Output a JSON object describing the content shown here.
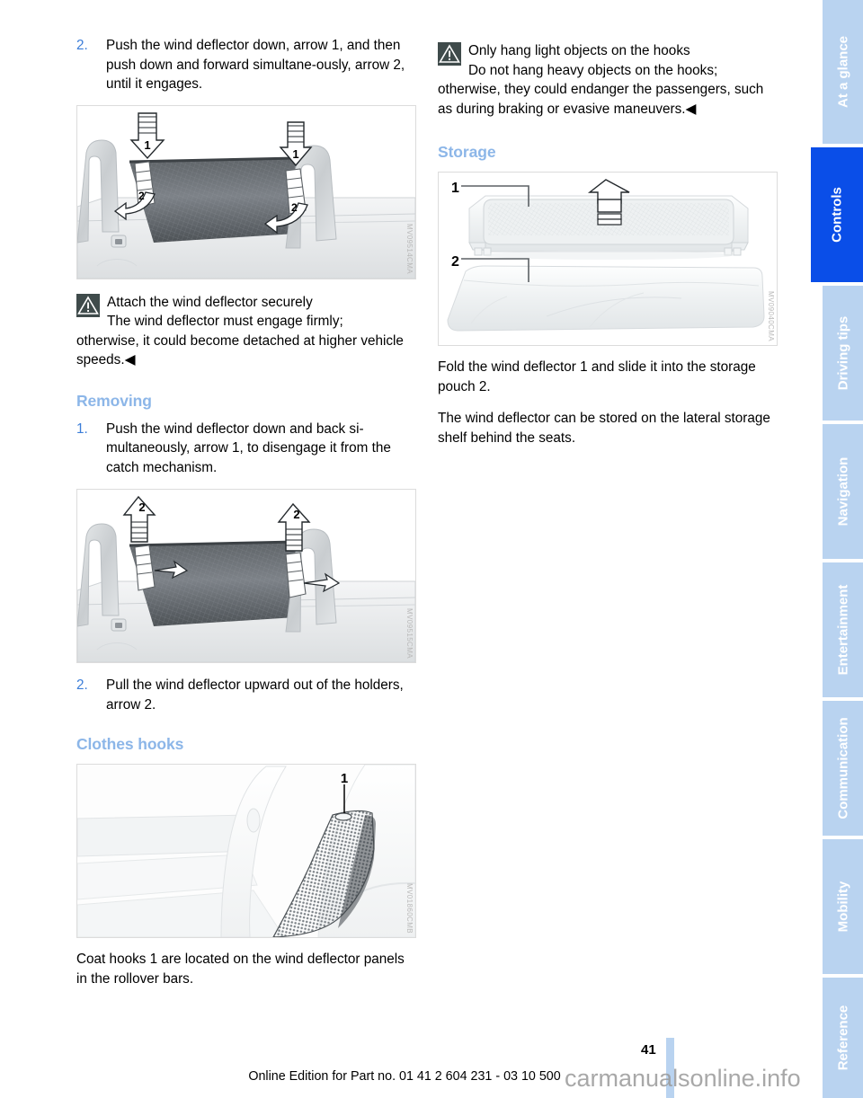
{
  "page": {
    "number": "41",
    "footer": "Online Edition for Part no. 01 41 2 604 231 - 03 10 500",
    "watermark": "carmanualsonline.info"
  },
  "left_column": {
    "step2": {
      "num": "2.",
      "text": "Push the wind deflector down, arrow 1, and then push down and forward simultane-ously, arrow 2, until it engages."
    },
    "figure1": {
      "code": "MV09514CMA",
      "alt": "Wind deflector between rollover bars with down arrows 1 and curved arrows 2"
    },
    "warning": {
      "icon": "warning-triangle-icon",
      "title": "Attach the wind deflector securely",
      "body": "The wind deflector must engage firmly;",
      "rest": "otherwise, it could become detached at higher vehicle speeds.◀"
    },
    "heading_removing": "Removing",
    "step_remove_1": {
      "num": "1.",
      "text": "Push the wind deflector down and back si-multaneously, arrow 1, to disengage it from the catch mechanism."
    },
    "figure2": {
      "code": "MV09515CMA",
      "alt": "Wind deflector with upward arrows 2"
    },
    "step_remove_2": {
      "num": "2.",
      "text": "Pull the wind deflector upward out of the holders, arrow 2."
    },
    "heading_clothes_hooks": "Clothes hooks",
    "figure3": {
      "code": "MV01860CMB",
      "alt": "Coat hook 1 on wind deflector panel in rollover bar"
    },
    "caption3": "Coat hooks 1 are located on the wind deflector panels in the rollover bars."
  },
  "right_column": {
    "warning": {
      "icon": "warning-triangle-icon",
      "title": "Only hang light objects on the hooks",
      "body": "Do not hang heavy objects on the hooks;",
      "rest": "otherwise, they could endanger the passengers, such as during braking or evasive maneuvers.◀"
    },
    "heading_storage": "Storage",
    "figure4": {
      "code": "MV09040CMA",
      "label_1": "1",
      "label_2": "2",
      "alt": "Folded wind deflector 1 and storage pouch 2"
    },
    "para1": "Fold the wind deflector 1 and slide it into the storage pouch 2.",
    "para2": "The wind deflector can be stored on the lateral storage shelf behind the seats."
  },
  "sidebar": {
    "tabs": [
      {
        "label": "At a glance",
        "active": false
      },
      {
        "label": "Controls",
        "active": true
      },
      {
        "label": "Driving tips",
        "active": false
      },
      {
        "label": "Navigation",
        "active": false
      },
      {
        "label": "Entertainment",
        "active": false
      },
      {
        "label": "Communication",
        "active": false
      },
      {
        "label": "Mobility",
        "active": false
      },
      {
        "label": "Reference",
        "active": false
      }
    ]
  },
  "colors": {
    "accent_heading": "#8cb6e8",
    "tab_inactive": "#b9d3f0",
    "tab_active": "#0a4ee8",
    "step_number": "#3b7dd8",
    "warning_box": "#3f4b4b"
  }
}
